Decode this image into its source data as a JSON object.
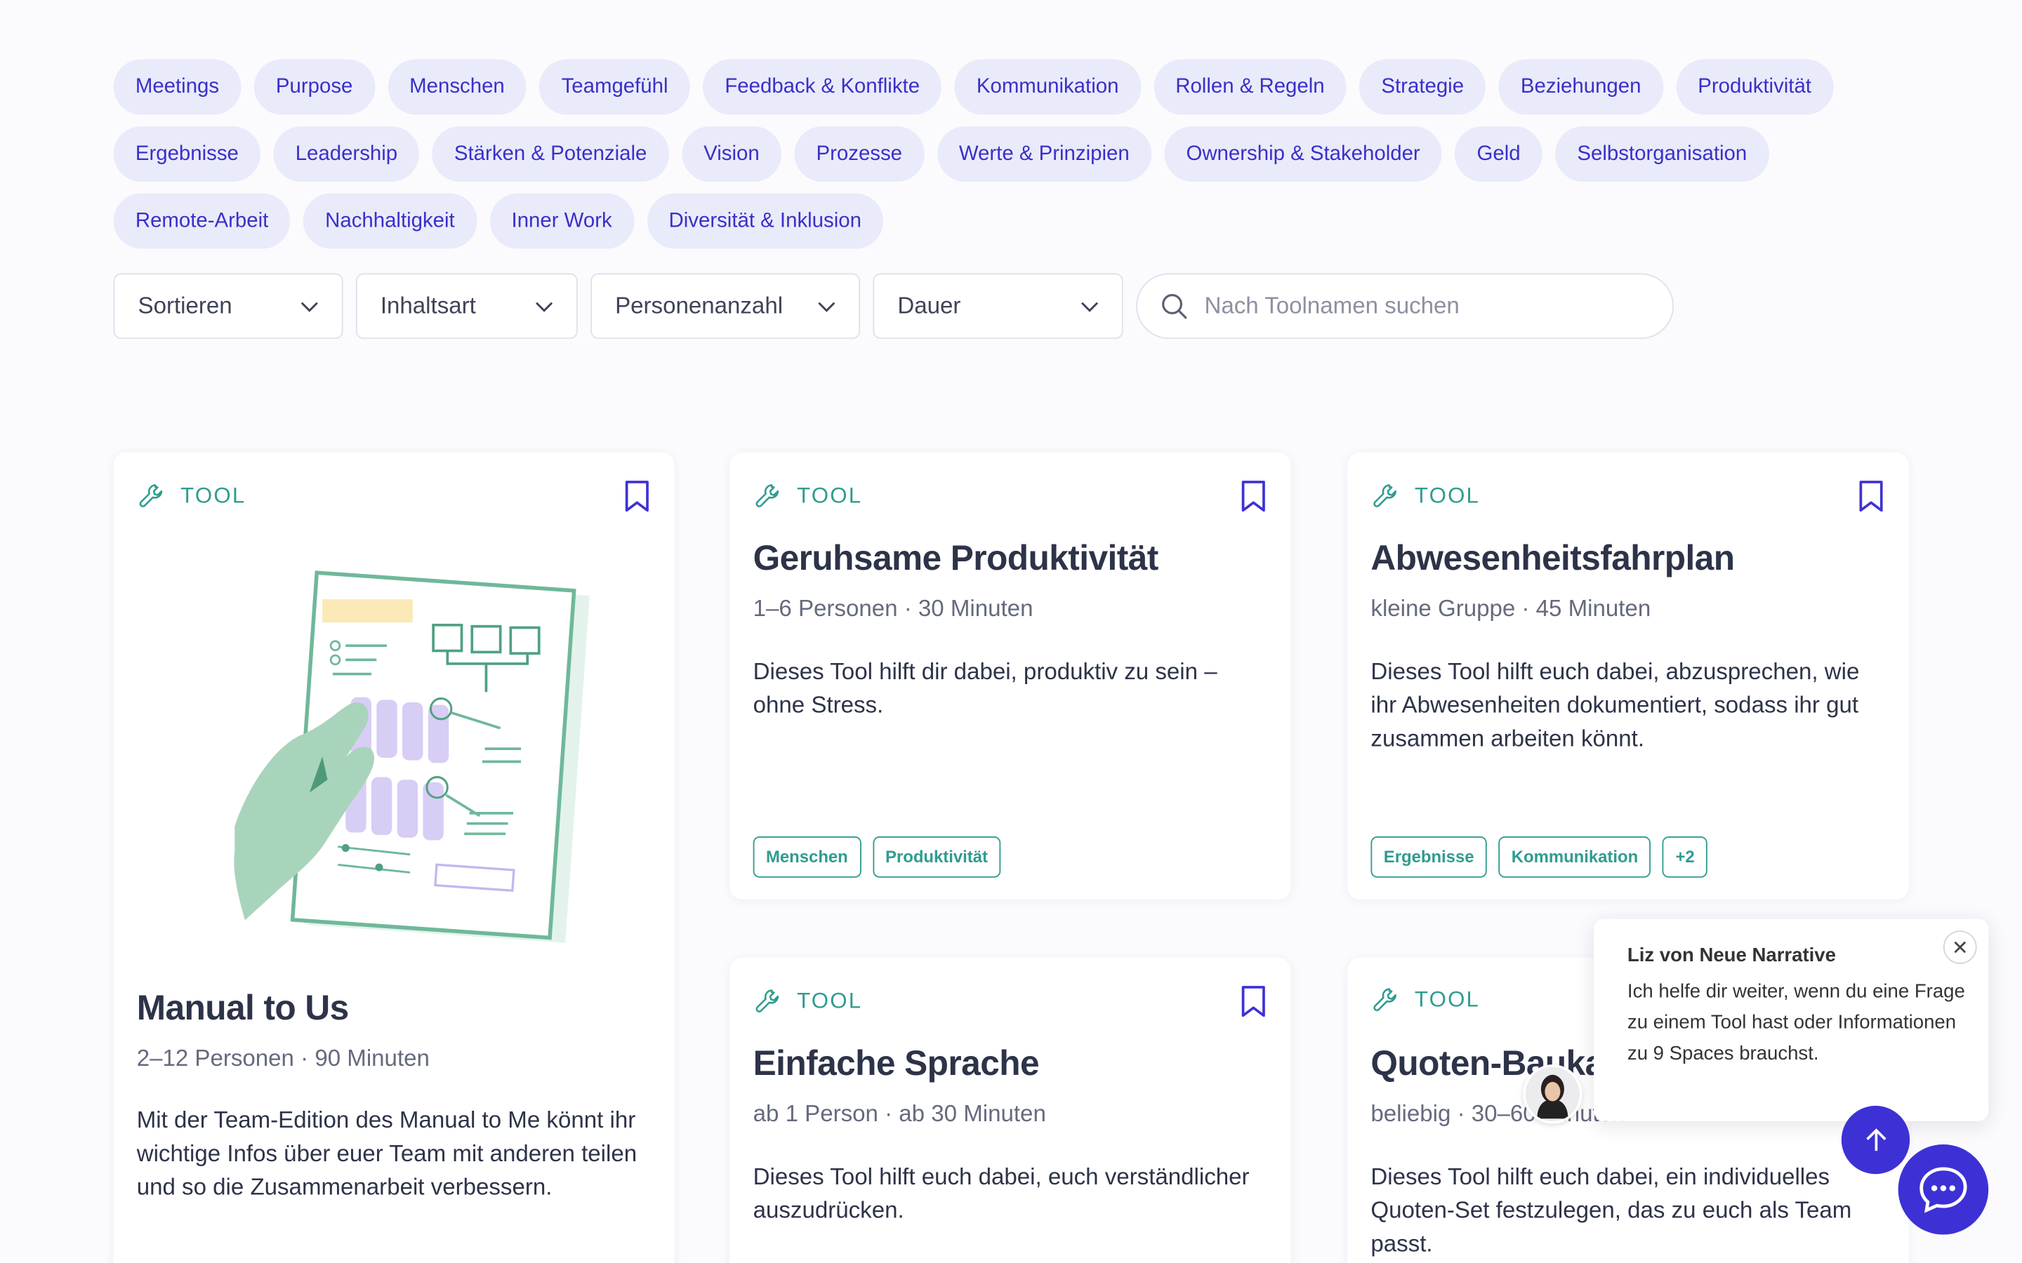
{
  "topics": [
    "Meetings",
    "Purpose",
    "Menschen",
    "Teamgefühl",
    "Feedback & Konflikte",
    "Kommunikation",
    "Rollen & Regeln",
    "Strategie",
    "Beziehungen",
    "Produktivität",
    "Ergebnisse",
    "Leadership",
    "Stärken & Potenziale",
    "Vision",
    "Prozesse",
    "Werte & Prinzipien",
    "Ownership & Stakeholder",
    "Geld",
    "Selbstorganisation",
    "Remote-Arbeit",
    "Nachhaltigkeit",
    "Inner Work",
    "Diversität & Inklusion"
  ],
  "filters": {
    "sort": "Sortieren",
    "content_type": "Inhaltsart",
    "people": "Personenanzahl",
    "duration": "Dauer",
    "search_placeholder": "Nach Toolnamen suchen"
  },
  "colors": {
    "accent": "#3d31d6",
    "chip_bg": "#e9ebfa",
    "chip_text": "#3b2fc9",
    "teal": "#2f9c8f"
  },
  "cards": [
    {
      "kind": "TOOL",
      "title": "Manual to Us",
      "meta": "2–12 Personen · 90 Minuten",
      "desc": "Mit der Team-Edition des Manual to Me könnt ihr wichtige Infos über euer Team mit anderen teilen und so die Zusammenarbeit verbessern.",
      "tags": []
    },
    {
      "kind": "TOOL",
      "title": "Geruhsame Produktivität",
      "meta": "1–6 Personen · 30 Minuten",
      "desc": "Dieses Tool hilft dir dabei, produktiv zu sein – ohne Stress.",
      "tags": [
        "Menschen",
        "Produktivität"
      ]
    },
    {
      "kind": "TOOL",
      "title": "Abwesenheitsfahrplan",
      "meta": "kleine Gruppe · 45 Minuten",
      "desc": "Dieses Tool hilft euch dabei, abzusprechen, wie ihr Abwesenheiten dokumentiert, sodass ihr gut zusammen arbeiten könnt.",
      "tags": [
        "Ergebnisse",
        "Kommunikation",
        "+2"
      ]
    },
    {
      "kind": "TOOL",
      "title": "Einfache Sprache",
      "meta": "ab 1 Person · ab 30 Minuten",
      "desc": "Dieses Tool hilft euch dabei, euch verständlicher auszudrücken.",
      "tags": []
    },
    {
      "kind": "TOOL",
      "title": "Quoten-Baukasten",
      "meta": "beliebig · 30–60 Minuten",
      "desc": "Dieses Tool hilft euch dabei, ein individuelles Quoten-Set festzulegen, das zu euch als Team passt.",
      "tags": []
    }
  ],
  "chat": {
    "sender": "Liz von Neue Narrative",
    "message": "Ich helfe dir weiter, wenn du eine Frage zu einem Tool hast oder Informationen zu 9 Spaces brauchst."
  }
}
